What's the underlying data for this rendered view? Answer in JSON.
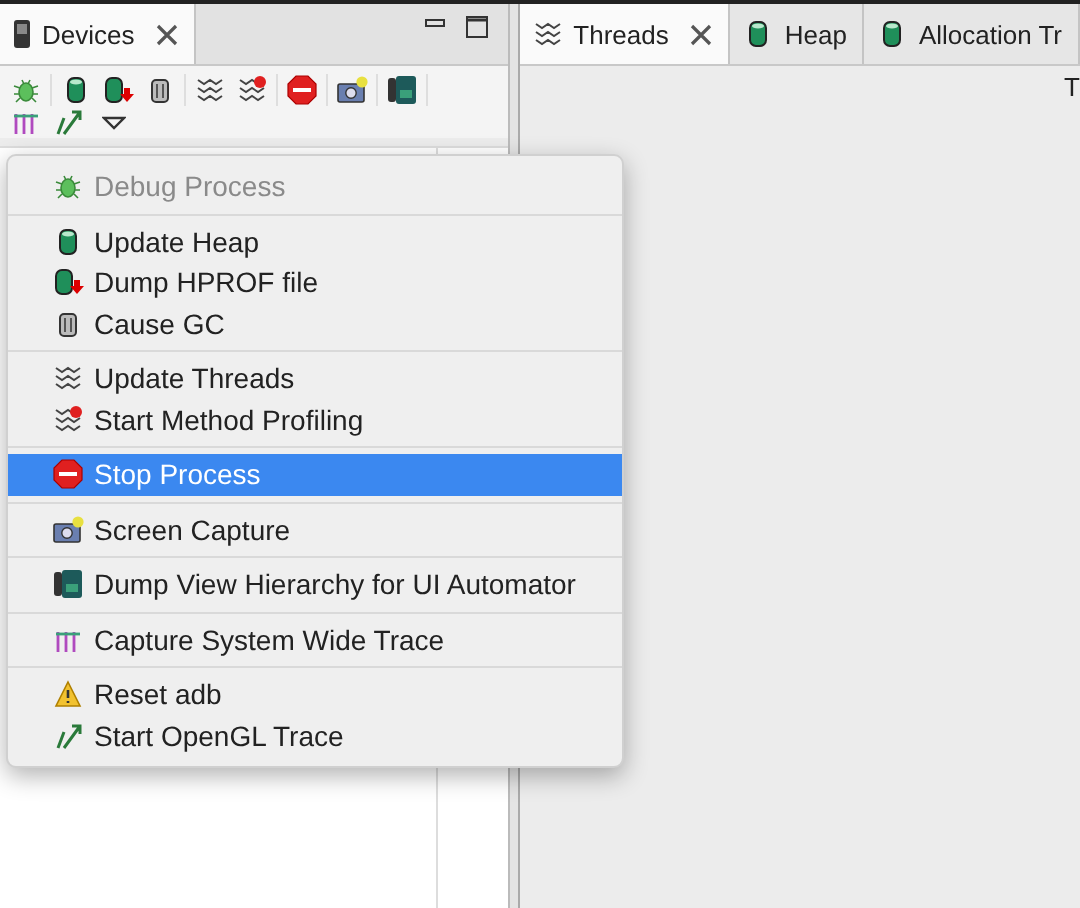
{
  "left_panel": {
    "tab": {
      "label": "Devices",
      "selected": true
    },
    "toolbar": [
      [
        {
          "kind": "bug"
        }
      ],
      [
        {
          "kind": "heap"
        },
        {
          "kind": "dump"
        },
        {
          "kind": "gc"
        }
      ],
      [
        {
          "kind": "threads"
        },
        {
          "kind": "profiling"
        }
      ],
      [
        {
          "kind": "stop"
        }
      ],
      [
        {
          "kind": "camera"
        }
      ],
      [
        {
          "kind": "hierarchy"
        }
      ],
      [
        {
          "kind": "systrace"
        },
        {
          "kind": "opengl"
        }
      ]
    ]
  },
  "menu": {
    "groups": [
      [
        {
          "label": "Debug Process",
          "kind": "bug",
          "disabled": true,
          "selected": false
        }
      ],
      [
        {
          "label": "Update Heap",
          "kind": "heap",
          "disabled": false,
          "selected": false
        },
        {
          "label": "Dump HPROF file",
          "kind": "dump",
          "disabled": false,
          "selected": false
        },
        {
          "label": "Cause GC",
          "kind": "gc",
          "disabled": false,
          "selected": false
        }
      ],
      [
        {
          "label": "Update Threads",
          "kind": "threads",
          "disabled": false,
          "selected": false
        },
        {
          "label": "Start Method Profiling",
          "kind": "profiling",
          "disabled": false,
          "selected": false
        }
      ],
      [
        {
          "label": "Stop Process",
          "kind": "stop",
          "disabled": false,
          "selected": true
        }
      ],
      [
        {
          "label": "Screen Capture",
          "kind": "camera",
          "disabled": false,
          "selected": false
        }
      ],
      [
        {
          "label": "Dump View Hierarchy for UI Automator",
          "kind": "hierarchy",
          "disabled": false,
          "selected": false
        }
      ],
      [
        {
          "label": "Capture System Wide Trace",
          "kind": "systrace",
          "disabled": false,
          "selected": false
        }
      ],
      [
        {
          "label": "Reset adb",
          "kind": "warning",
          "disabled": false,
          "selected": false
        },
        {
          "label": "Start OpenGL Trace",
          "kind": "opengl",
          "disabled": false,
          "selected": false
        }
      ]
    ]
  },
  "right_panel": {
    "tabs": [
      {
        "label": "Threads",
        "kind": "threads",
        "selected": true
      },
      {
        "label": "Heap",
        "kind": "heap",
        "selected": false
      },
      {
        "label": "Allocation Tr",
        "kind": "heap",
        "selected": false
      }
    ],
    "content_text": "T"
  }
}
